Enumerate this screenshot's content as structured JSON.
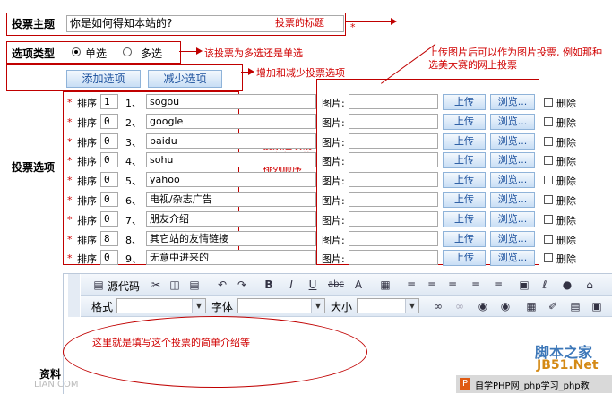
{
  "form": {
    "topic_label": "投票主题",
    "topic_value": "你是如何得知本站的?",
    "type_label": "选项类型",
    "type_single": "单选",
    "type_multi": "多选",
    "add_option": "添加选项",
    "remove_option": "减少选项",
    "options_label": "投票选项",
    "sort_label": "排序",
    "image_label": "图片:",
    "upload": "上传",
    "browse": "浏览...",
    "delete": "删除",
    "options": [
      {
        "sort": "1",
        "num": "1、",
        "text": "sogou"
      },
      {
        "sort": "0",
        "num": "2、",
        "text": "google"
      },
      {
        "sort": "0",
        "num": "3、",
        "text": "baidu"
      },
      {
        "sort": "0",
        "num": "4、",
        "text": "sohu"
      },
      {
        "sort": "0",
        "num": "5、",
        "text": "yahoo"
      },
      {
        "sort": "0",
        "num": "6、",
        "text": "电视/杂志广告"
      },
      {
        "sort": "0",
        "num": "7、",
        "text": "朋友介绍"
      },
      {
        "sort": "8",
        "num": "8、",
        "text": "其它站的友情链接"
      },
      {
        "sort": "0",
        "num": "9、",
        "text": "无意中进来的"
      }
    ],
    "intro_label": "资料"
  },
  "editor": {
    "source_label": "源代码",
    "format_label": "格式",
    "font_label": "字体",
    "size_label": "大小"
  },
  "annotations": {
    "topic": "投票的标题",
    "type": "该投票为多选还是单选",
    "addremove": "增加和减少投票选项",
    "sort": "投票选项设置和每项的排列顺序",
    "image": "上传图片后可以作为图片投票, 例如那种选美大赛的网上投票",
    "intro": "这里就是填写这个投票的简单介绍等"
  },
  "watermarks": {
    "site_cn": "脚本之家",
    "site_en": "JB51.Net",
    "bottom_bar": "自学PHP网_php学习_php教",
    "bottom_left": "LIAN.COM"
  },
  "colors": {
    "annotation": "#c00000",
    "button_text": "#1a4f9c"
  }
}
